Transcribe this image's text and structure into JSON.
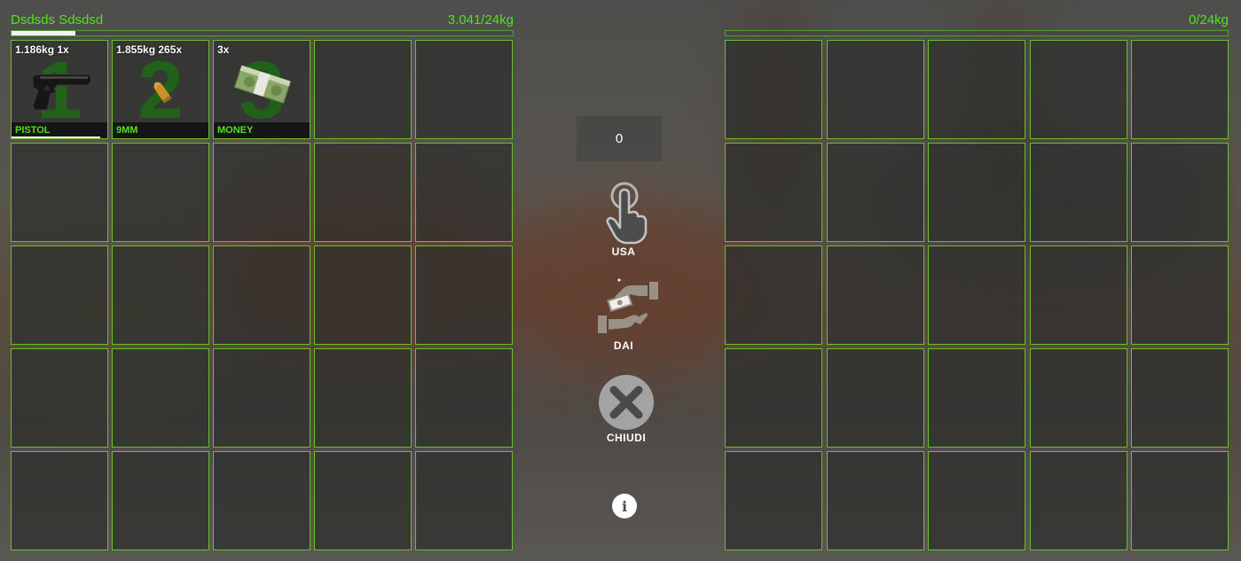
{
  "left_inventory": {
    "owner_name": "Dsdsds Sdsdsd",
    "weight_text": "3.041/24kg",
    "weight_fraction": 0.127,
    "items": [
      {
        "slot_number": "1",
        "info": "1.186kg 1x",
        "label": "PISTOL",
        "icon": "pistol-icon",
        "durability_fraction": 0.93
      },
      {
        "slot_number": "2",
        "info": "1.855kg 265x",
        "label": "9MM",
        "icon": "bullet-icon"
      },
      {
        "slot_number": "3",
        "info": "3x",
        "label": "MONEY",
        "icon": "money-stack-icon"
      }
    ]
  },
  "right_inventory": {
    "weight_text": "0/24kg",
    "weight_fraction": 0
  },
  "actions": {
    "amount_value": "0",
    "use_label": "USA",
    "give_label": "DAI",
    "close_label": "CHIUDI",
    "info_symbol": "i"
  },
  "colors": {
    "accent": "#55e01e",
    "slot_border": "#6bbf2a",
    "slot_number": "#1e6a16"
  }
}
